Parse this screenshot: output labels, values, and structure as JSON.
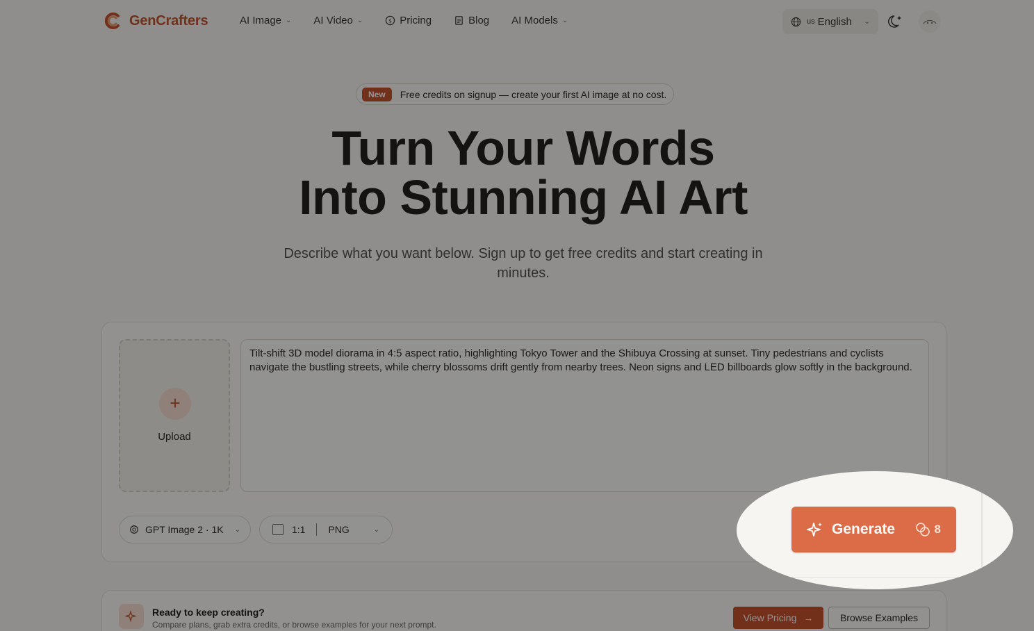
{
  "nav": {
    "brand": "GenCrafters",
    "links": [
      {
        "label": "AI Image",
        "dropdown": true
      },
      {
        "label": "AI Video",
        "dropdown": true
      },
      {
        "label": "Pricing",
        "icon": "coin-icon"
      },
      {
        "label": "Blog",
        "icon": "document-icon"
      },
      {
        "label": "AI Models",
        "dropdown": true
      }
    ],
    "language": {
      "flag": "us",
      "label": "English"
    }
  },
  "hero": {
    "badge_tag": "New",
    "badge_text": "Free credits on signup — create your first AI image at no cost.",
    "title_line1": "Turn Your Words",
    "title_line2": "Into Stunning AI Art",
    "subtitle": "Describe what you want below. Sign up to get free credits and start creating in minutes."
  },
  "editor": {
    "upload_label": "Upload",
    "prompt_value": "Tilt-shift 3D model diorama in 4:5 aspect ratio, highlighting Tokyo Tower and the Shibuya Crossing at sunset. Tiny pedestrians and cyclists navigate the bustling streets, while cherry blossoms drift gently from nearby trees. Neon signs and LED billboards glow softly in the background.",
    "model": "GPT Image 2 · 1K",
    "ratio": "1:1",
    "format": "PNG",
    "generate_label": "Generate",
    "credit_cost": "8"
  },
  "cta": {
    "title": "Ready to keep creating?",
    "subtitle": "Compare plans, grab extra credits, or browse examples for your next prompt.",
    "pricing_label": "View Pricing",
    "examples_label": "Browse Examples"
  },
  "colors": {
    "accent": "#c4522e",
    "generate": "#dc6c48",
    "background": "#f7f5f1"
  }
}
